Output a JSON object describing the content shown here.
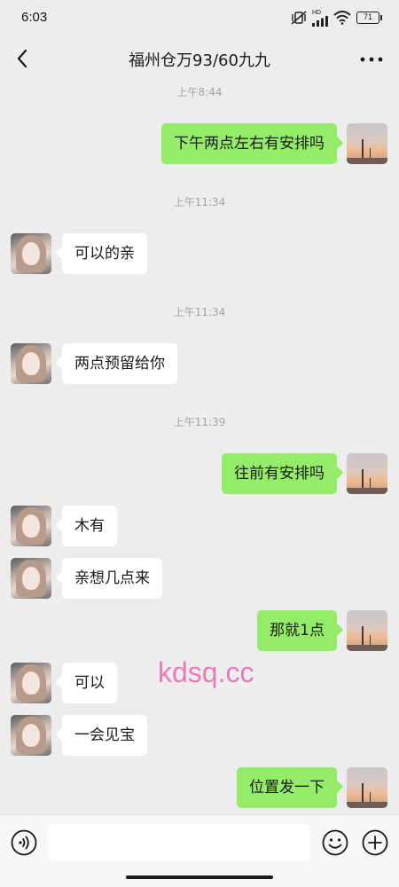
{
  "status_bar": {
    "time": "6:03",
    "network_badge": "HD",
    "battery": "71",
    "icons": [
      "vibrate-off-icon",
      "signal-icon",
      "wifi-icon",
      "battery-icon"
    ]
  },
  "header": {
    "title": "福州仓万93/60九九",
    "back_icon": "chevron-left-icon",
    "more_icon": "more-dots-icon"
  },
  "messages": [
    {
      "kind": "time",
      "text": "上午8:44"
    },
    {
      "kind": "msg",
      "side": "right",
      "text": "下午两点左右有安排吗"
    },
    {
      "kind": "time",
      "text": "上午11:34"
    },
    {
      "kind": "msg",
      "side": "left",
      "text": "可以的亲"
    },
    {
      "kind": "time",
      "text": "上午11:34"
    },
    {
      "kind": "msg",
      "side": "left",
      "text": "两点预留给你"
    },
    {
      "kind": "time",
      "text": "上午11:39"
    },
    {
      "kind": "msg",
      "side": "right",
      "text": "往前有安排吗"
    },
    {
      "kind": "msg",
      "side": "left",
      "text": "木有"
    },
    {
      "kind": "msg",
      "side": "left",
      "text": "亲想几点来"
    },
    {
      "kind": "msg",
      "side": "right",
      "text": "那就1点"
    },
    {
      "kind": "msg",
      "side": "left",
      "text": "可以"
    },
    {
      "kind": "msg",
      "side": "left",
      "text": "一会见宝"
    },
    {
      "kind": "msg",
      "side": "right",
      "text": "位置发一下"
    }
  ],
  "watermark": "kdsq.cc",
  "input_bar": {
    "value": "",
    "placeholder": "",
    "voice_icon": "voice-icon",
    "emoji_icon": "emoji-icon",
    "plus_icon": "plus-icon"
  },
  "colors": {
    "background": "#ededed",
    "sent_bubble": "#95ec69",
    "received_bubble": "#ffffff",
    "timestamp": "#a3a3a3",
    "watermark": "#e86fb0"
  }
}
